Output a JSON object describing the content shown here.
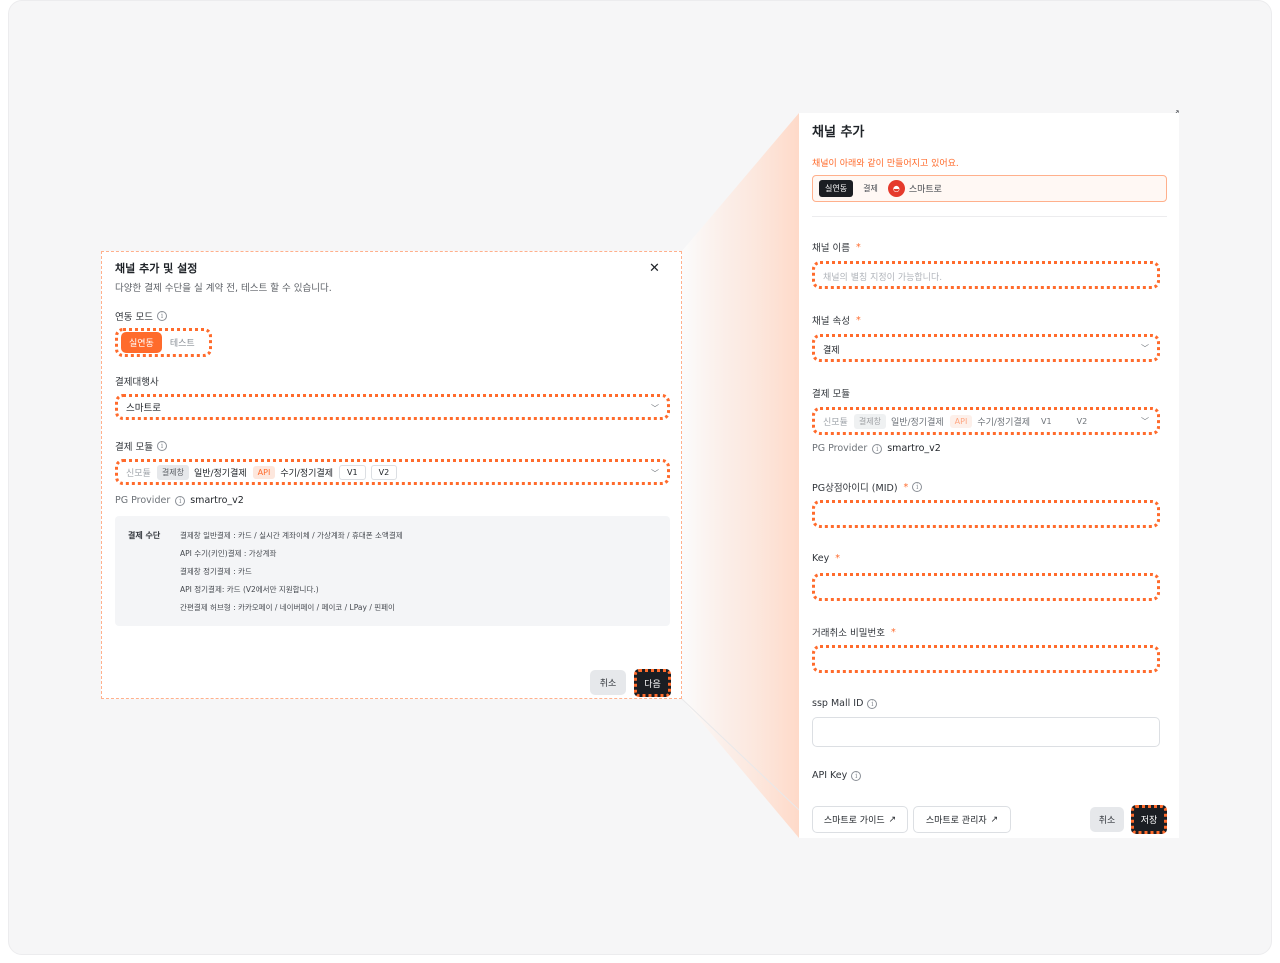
{
  "left_modal": {
    "title": "채널 추가 및 설정",
    "close_glyph": "✕",
    "subtitle": "다양한 결제 수단을 실 계약 전, 테스트 할 수 있습니다.",
    "mode": {
      "label": "연동 모드",
      "options": [
        "실연동",
        "테스트"
      ],
      "selected": "실연동"
    },
    "pg_agency": {
      "label": "결제대행사",
      "value": "스마트로"
    },
    "payment_module": {
      "label": "결제 모듈",
      "items": [
        "신모듈",
        "결제창",
        "일반/정기결제",
        "API",
        "수기/정기결제",
        "V1",
        "V2"
      ]
    },
    "pg_provider": {
      "label": "PG Provider",
      "value": "smartro_v2"
    },
    "methods": {
      "heading": "결제 수단",
      "lines": [
        "결제창 일반결제 : 카드 / 실시간 계좌이체 / 가상계좌 / 휴대폰 소액결제",
        "API 수기(키인)결제 : 가상계좌",
        "결제창 정기결제 : 카드",
        "API 정기결제: 카드 (V2에서만 지원합니다.)",
        "간편결제 허브형 : 카카오페이 / 네이버페이 / 페이코 / LPay / 핀페이"
      ]
    },
    "cancel_label": "취소",
    "next_label": "다음"
  },
  "right_panel": {
    "title": "채널 추가",
    "notice": "채널이 아래와 같이 만들어지고 있어요.",
    "preview": {
      "mode": "실연동",
      "type": "결제",
      "provider": "스마트로"
    },
    "channel_name": {
      "label": "채널 이름",
      "placeholder": "채널의 별칭 지정이 가능합니다."
    },
    "channel_attr": {
      "label": "채널 속성",
      "value": "결제"
    },
    "payment_module": {
      "label": "결제 모듈",
      "items": [
        "신모듈",
        "결제창",
        "일반/정기결제",
        "API",
        "수기/정기결제",
        "V1",
        "V2"
      ]
    },
    "pg_provider": {
      "label": "PG Provider",
      "value": "smartro_v2"
    },
    "mid_label": "PG상점아이디 (MID)",
    "key_label": "Key",
    "cancel_pw_label": "거래취소 비밀번호",
    "ssp_label": "ssp Mall ID",
    "api_key_label": "API Key",
    "guide_btn": "스마트로 가이드",
    "admin_btn": "스마트로 관리자",
    "external_glyph": "↗",
    "cancel_label": "취소",
    "save_label": "저장"
  },
  "colors": {
    "accent": "#ff6b2c",
    "dark": "#1b1e23",
    "gray_bg": "#f6f6f7"
  },
  "icons": {
    "info": "info-icon",
    "chevron": "chevron-down-icon",
    "close": "close-icon"
  }
}
